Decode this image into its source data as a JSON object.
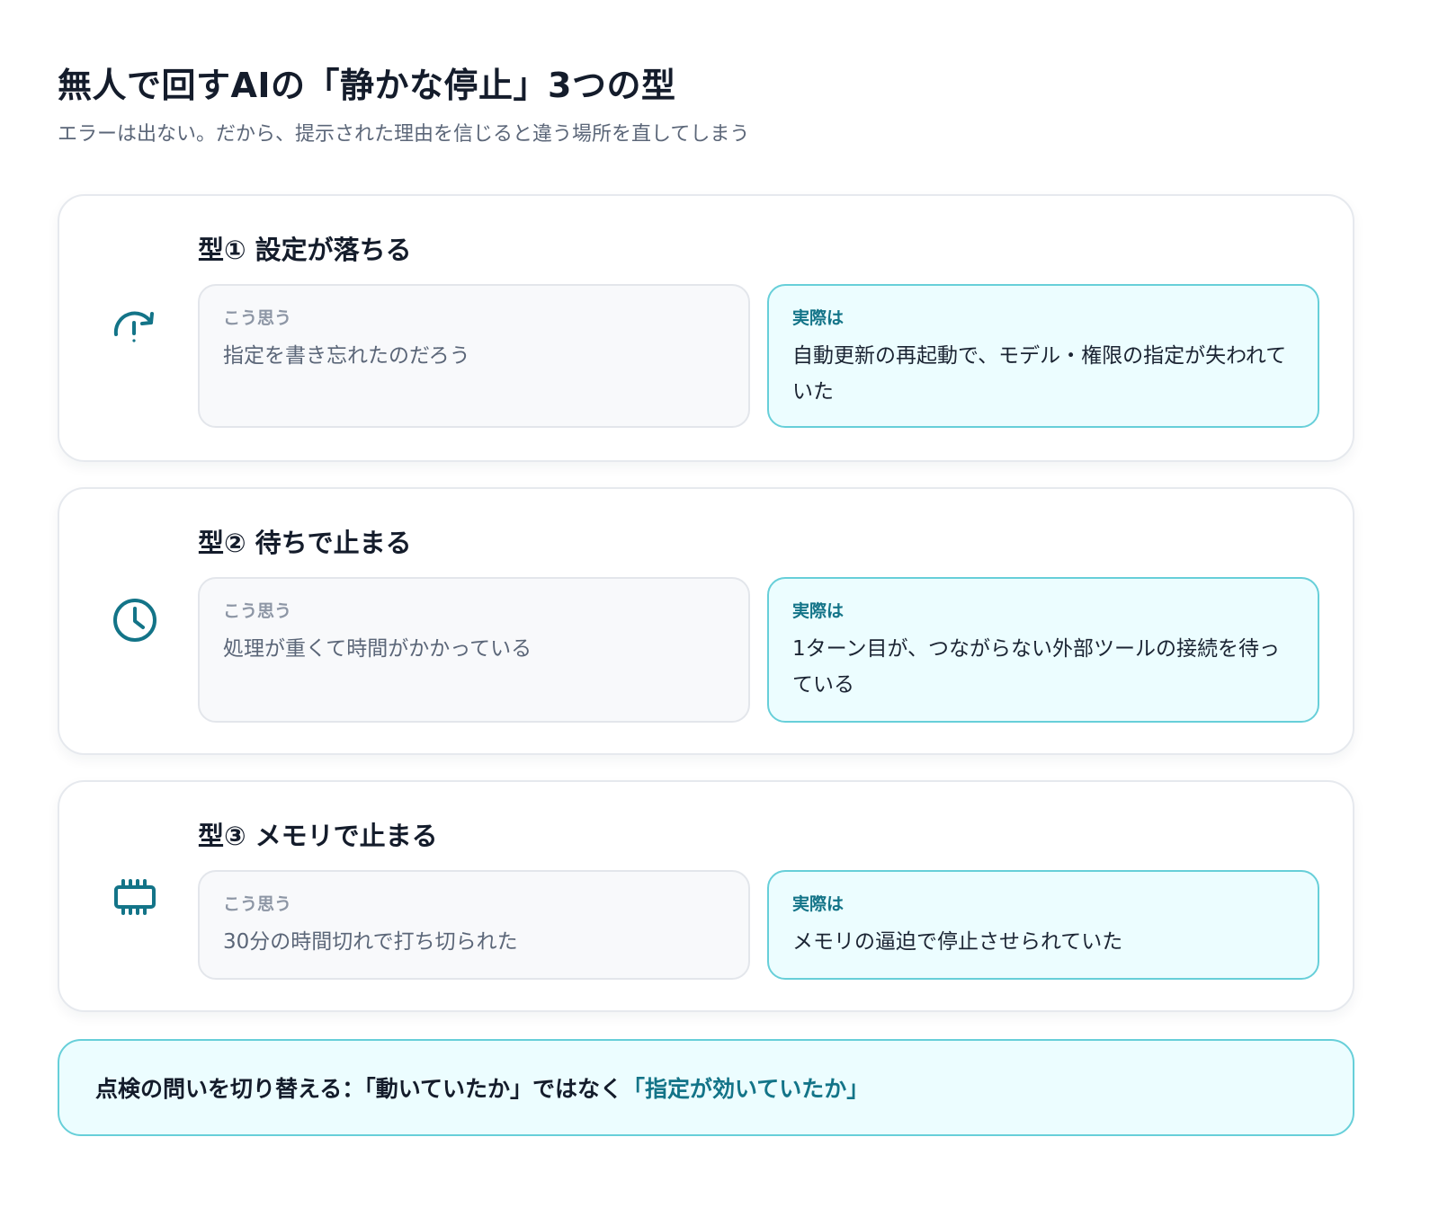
{
  "header": {
    "title": "無人で回すAIの「静かな停止」3つの型",
    "subtitle": "エラーは出ない。だから、提示された理由を信じると違う場所を直してしまう"
  },
  "colors": {
    "accent": "#137488",
    "accent_border": "#67cfd9",
    "accent_bg": "#ecfdff"
  },
  "cards": [
    {
      "icon": "refresh-warning-icon",
      "title": "型① 設定が落ちる",
      "assume_label": "こう思う",
      "assume_text": "指定を書き忘れたのだろう",
      "actual_label": "実際は",
      "actual_text": "自動更新の再起動で、モデル・権限の指定が失われていた"
    },
    {
      "icon": "clock-icon",
      "title": "型② 待ちで止まる",
      "assume_label": "こう思う",
      "assume_text": "処理が重くて時間がかかっている",
      "actual_label": "実際は",
      "actual_text": "1ターン目が、つながらない外部ツールの接続を待っている"
    },
    {
      "icon": "memory-chip-icon",
      "title": "型③ メモリで止まる",
      "assume_label": "こう思う",
      "assume_text": "30分の時間切れで打ち切られた",
      "actual_label": "実際は",
      "actual_text": "メモリの逼迫で停止させられていた"
    }
  ],
  "footer": {
    "text_prefix": "点検の問いを切り替える：「動いていたか」ではなく",
    "text_highlight": "「指定が効いていたか」"
  }
}
